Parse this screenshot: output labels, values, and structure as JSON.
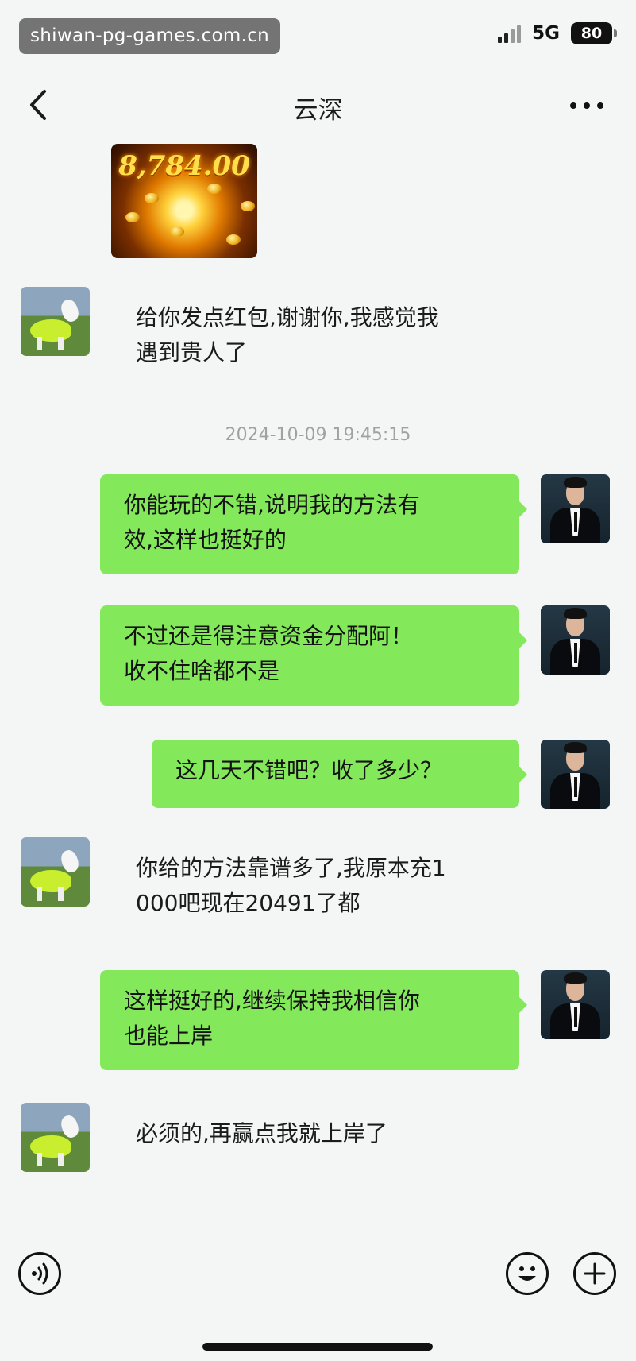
{
  "status_bar": {
    "watermark": "shiwan-pg-games.com.cn",
    "network": "5G",
    "battery": "80"
  },
  "nav_bar": {
    "title": "云深",
    "back_icon": "back-chevron-icon",
    "more_icon": "more-horizontal-icon"
  },
  "chat": {
    "image_message": {
      "amount": "8,784.00"
    },
    "timestamp": "2024-10-09 19:45:15",
    "messages": [
      {
        "side": "left",
        "text": "给你发点红包,谢谢你,我感觉我\n遇到贵人了"
      },
      {
        "side": "right",
        "text": "你能玩的不错,说明我的方法有\n效,这样也挺好的"
      },
      {
        "side": "right",
        "text": "不过还是得注意资金分配阿！\n收不住啥都不是"
      },
      {
        "side": "right",
        "text": "这几天不错吧？收了多少？"
      },
      {
        "side": "left",
        "text": "你给的方法靠谱多了,我原本充1\n000吧现在20491了都"
      },
      {
        "side": "right",
        "text": "这样挺好的,继续保持我相信你\n也能上岸"
      },
      {
        "side": "left",
        "text": "必须的,再赢点我就上岸了"
      }
    ]
  },
  "input_bar": {
    "voice_icon": "voice-input-icon",
    "emoji_icon": "emoji-icon",
    "plus_icon": "plus-icon"
  },
  "colors": {
    "background": "#f3f6f5",
    "sent_bubble": "#83e95a",
    "timestamp": "#a1a1a1"
  }
}
